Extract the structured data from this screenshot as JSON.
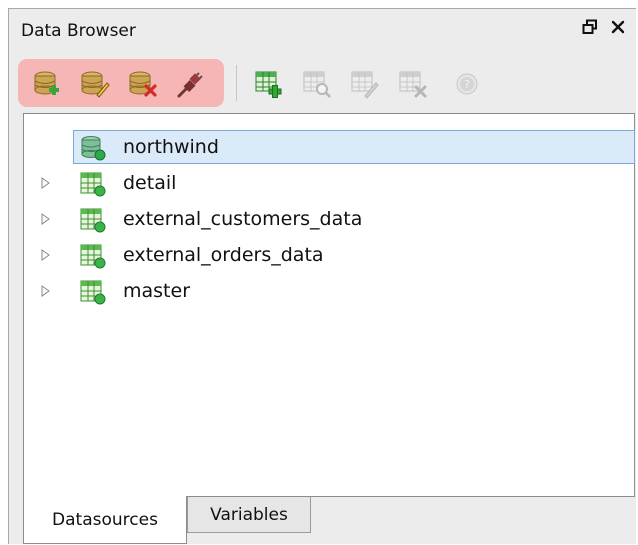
{
  "panel": {
    "title": "Data Browser",
    "controls": [
      {
        "name": "restore-icon",
        "glyph": "⧉"
      },
      {
        "name": "close-icon",
        "glyph": "✕"
      }
    ]
  },
  "toolbar": {
    "highlight_color": "#f6b6b6",
    "buttons": [
      {
        "name": "add-datasource-button",
        "icon": "database-add-icon",
        "enabled": true
      },
      {
        "name": "edit-datasource-button",
        "icon": "database-edit-icon",
        "enabled": true
      },
      {
        "name": "delete-datasource-button",
        "icon": "database-delete-icon",
        "enabled": true
      },
      {
        "name": "connect-datasource-button",
        "icon": "plug-connect-icon",
        "enabled": true
      },
      {
        "name": "add-dataset-button",
        "icon": "table-add-icon",
        "enabled": true
      },
      {
        "name": "preview-dataset-button",
        "icon": "table-preview-icon",
        "enabled": false
      },
      {
        "name": "edit-dataset-button",
        "icon": "table-edit-icon",
        "enabled": false
      },
      {
        "name": "delete-dataset-button",
        "icon": "table-delete-icon",
        "enabled": false
      },
      {
        "name": "help-button",
        "icon": "help-icon",
        "enabled": false
      }
    ]
  },
  "tree": {
    "root": {
      "label": "northwind",
      "icon": "database-icon",
      "selected": true
    },
    "children": [
      {
        "label": "detail",
        "icon": "table-icon"
      },
      {
        "label": "external_customers_data",
        "icon": "table-icon"
      },
      {
        "label": "external_orders_data",
        "icon": "table-icon"
      },
      {
        "label": "master",
        "icon": "table-icon"
      }
    ]
  },
  "tabs": [
    {
      "label": "Datasources",
      "active": true
    },
    {
      "label": "Variables",
      "active": false
    }
  ]
}
